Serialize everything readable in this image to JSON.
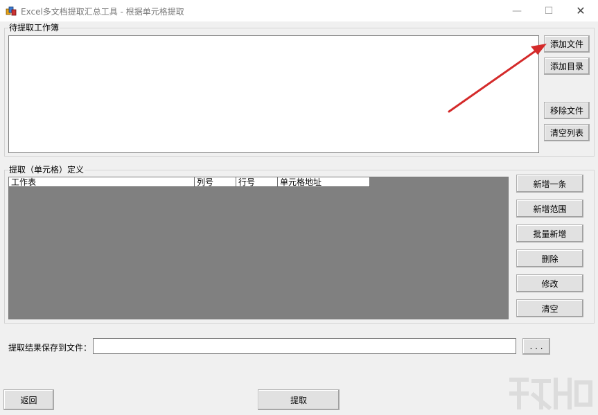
{
  "window": {
    "title": "Excel多文档提取汇总工具 - 根据单元格提取",
    "minimize_glyph": "—",
    "maximize_glyph": "☐",
    "close_glyph": "✕"
  },
  "workbook_group": {
    "title": "待提取工作簿",
    "buttons": {
      "add_file": "添加文件",
      "add_directory": "添加目录",
      "remove_file": "移除文件",
      "clear_list": "清空列表"
    }
  },
  "definition_group": {
    "title": "提取（单元格）定义",
    "columns": [
      "工作表",
      "列号",
      "行号",
      "单元格地址"
    ],
    "buttons": {
      "add_one": "新增一条",
      "add_range": "新增范围",
      "batch_add": "批量新增",
      "delete": "删除",
      "modify": "修改",
      "clear": "清空"
    }
  },
  "save": {
    "label": "提取结果保存到文件：",
    "value": "",
    "browse": ". . ."
  },
  "footer": {
    "back": "返回",
    "extract": "提取"
  },
  "icons": {
    "app": "app-icon",
    "arrow": "red-arrow-annotation"
  },
  "colors": {
    "grid_bg": "#808080",
    "arrow": "#d42a2a"
  }
}
